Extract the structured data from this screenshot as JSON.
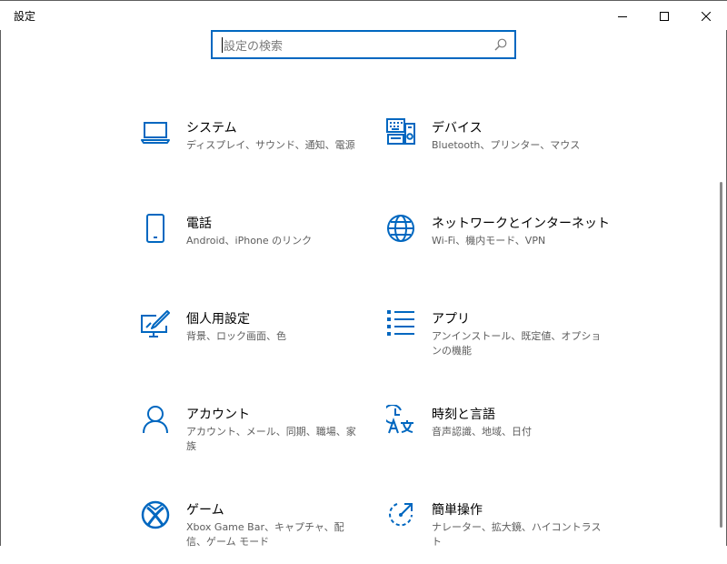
{
  "window": {
    "title": "設定"
  },
  "search": {
    "placeholder": "設定の検索"
  },
  "tiles": [
    {
      "name": "システム",
      "desc": "ディスプレイ、サウンド、通知、電源",
      "icon": "laptop-icon"
    },
    {
      "name": "デバイス",
      "desc": "Bluetooth、プリンター、マウス",
      "icon": "keyboard-icon"
    },
    {
      "name": "電話",
      "desc": "Android、iPhone のリンク",
      "icon": "phone-icon"
    },
    {
      "name": "ネットワークとインターネット",
      "desc": "Wi-Fi、機内モード、VPN",
      "icon": "globe-icon"
    },
    {
      "name": "個人用設定",
      "desc": "背景、ロック画面、色",
      "icon": "personalization-icon"
    },
    {
      "name": "アプリ",
      "desc": "アンインストール、既定値、オプションの機能",
      "icon": "apps-list-icon"
    },
    {
      "name": "アカウント",
      "desc": "アカウント、メール、同期、職場、家族",
      "icon": "account-icon"
    },
    {
      "name": "時刻と言語",
      "desc": "音声認識、地域、日付",
      "icon": "time-language-icon"
    },
    {
      "name": "ゲーム",
      "desc": "Xbox Game Bar、キャプチャ、配信、ゲーム モード",
      "icon": "xbox-icon"
    },
    {
      "name": "簡単操作",
      "desc": "ナレーター、拡大鏡、ハイコントラスト",
      "icon": "ease-of-access-icon"
    }
  ],
  "colors": {
    "accent": "#0067c0",
    "description": "#5d5d5d"
  }
}
